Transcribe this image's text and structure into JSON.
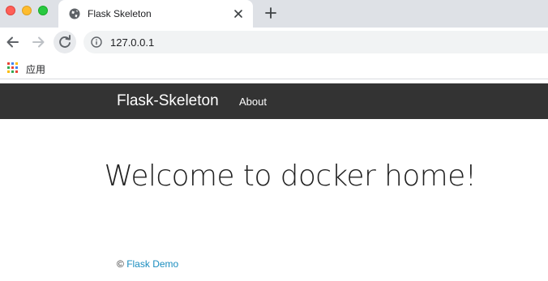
{
  "browser": {
    "tab": {
      "title": "Flask Skeleton"
    },
    "address_bar": {
      "url": "127.0.0.1"
    },
    "bookmarks_bar": {
      "apps_label": "应用"
    }
  },
  "navbar": {
    "brand": "Flask-Skeleton",
    "links": [
      {
        "label": "About"
      }
    ],
    "background": "#333333"
  },
  "main": {
    "heading": "Welcome to docker home!"
  },
  "footer": {
    "copyright_symbol": "©",
    "link_text": "Flask Demo",
    "link_color": "#1a8dbf"
  },
  "icons": {
    "tab_favicon": "globe-icon",
    "tab_close": "close-icon",
    "new_tab": "plus-icon",
    "back": "arrow-left-icon",
    "forward": "arrow-right-icon",
    "reload": "reload-icon",
    "site_info": "info-icon",
    "apps": "apps-grid-icon"
  }
}
